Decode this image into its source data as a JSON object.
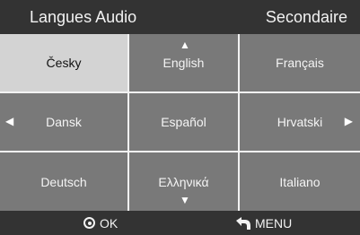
{
  "header": {
    "title": "Langues Audio",
    "mode": "Secondaire"
  },
  "languages": [
    {
      "label": "Česky",
      "selected": true
    },
    {
      "label": "English",
      "selected": false
    },
    {
      "label": "Français",
      "selected": false
    },
    {
      "label": "Dansk",
      "selected": false
    },
    {
      "label": "Español",
      "selected": false
    },
    {
      "label": "Hrvatski",
      "selected": false
    },
    {
      "label": "Deutsch",
      "selected": false
    },
    {
      "label": "Ελληνικά",
      "selected": false
    },
    {
      "label": "Italiano",
      "selected": false
    }
  ],
  "footer": {
    "ok_label": "OK",
    "menu_label": "MENU"
  },
  "icons": {
    "ok": "ok-icon",
    "menu": "back-menu-icon",
    "up": "arrow-up-icon",
    "down": "arrow-down-icon",
    "left": "arrow-left-icon",
    "right": "arrow-right-icon"
  },
  "colors": {
    "header_bg": "#333333",
    "cell_bg": "#797979",
    "selected_bg": "#d3d3d3",
    "grid_line": "#f2f2f2"
  }
}
